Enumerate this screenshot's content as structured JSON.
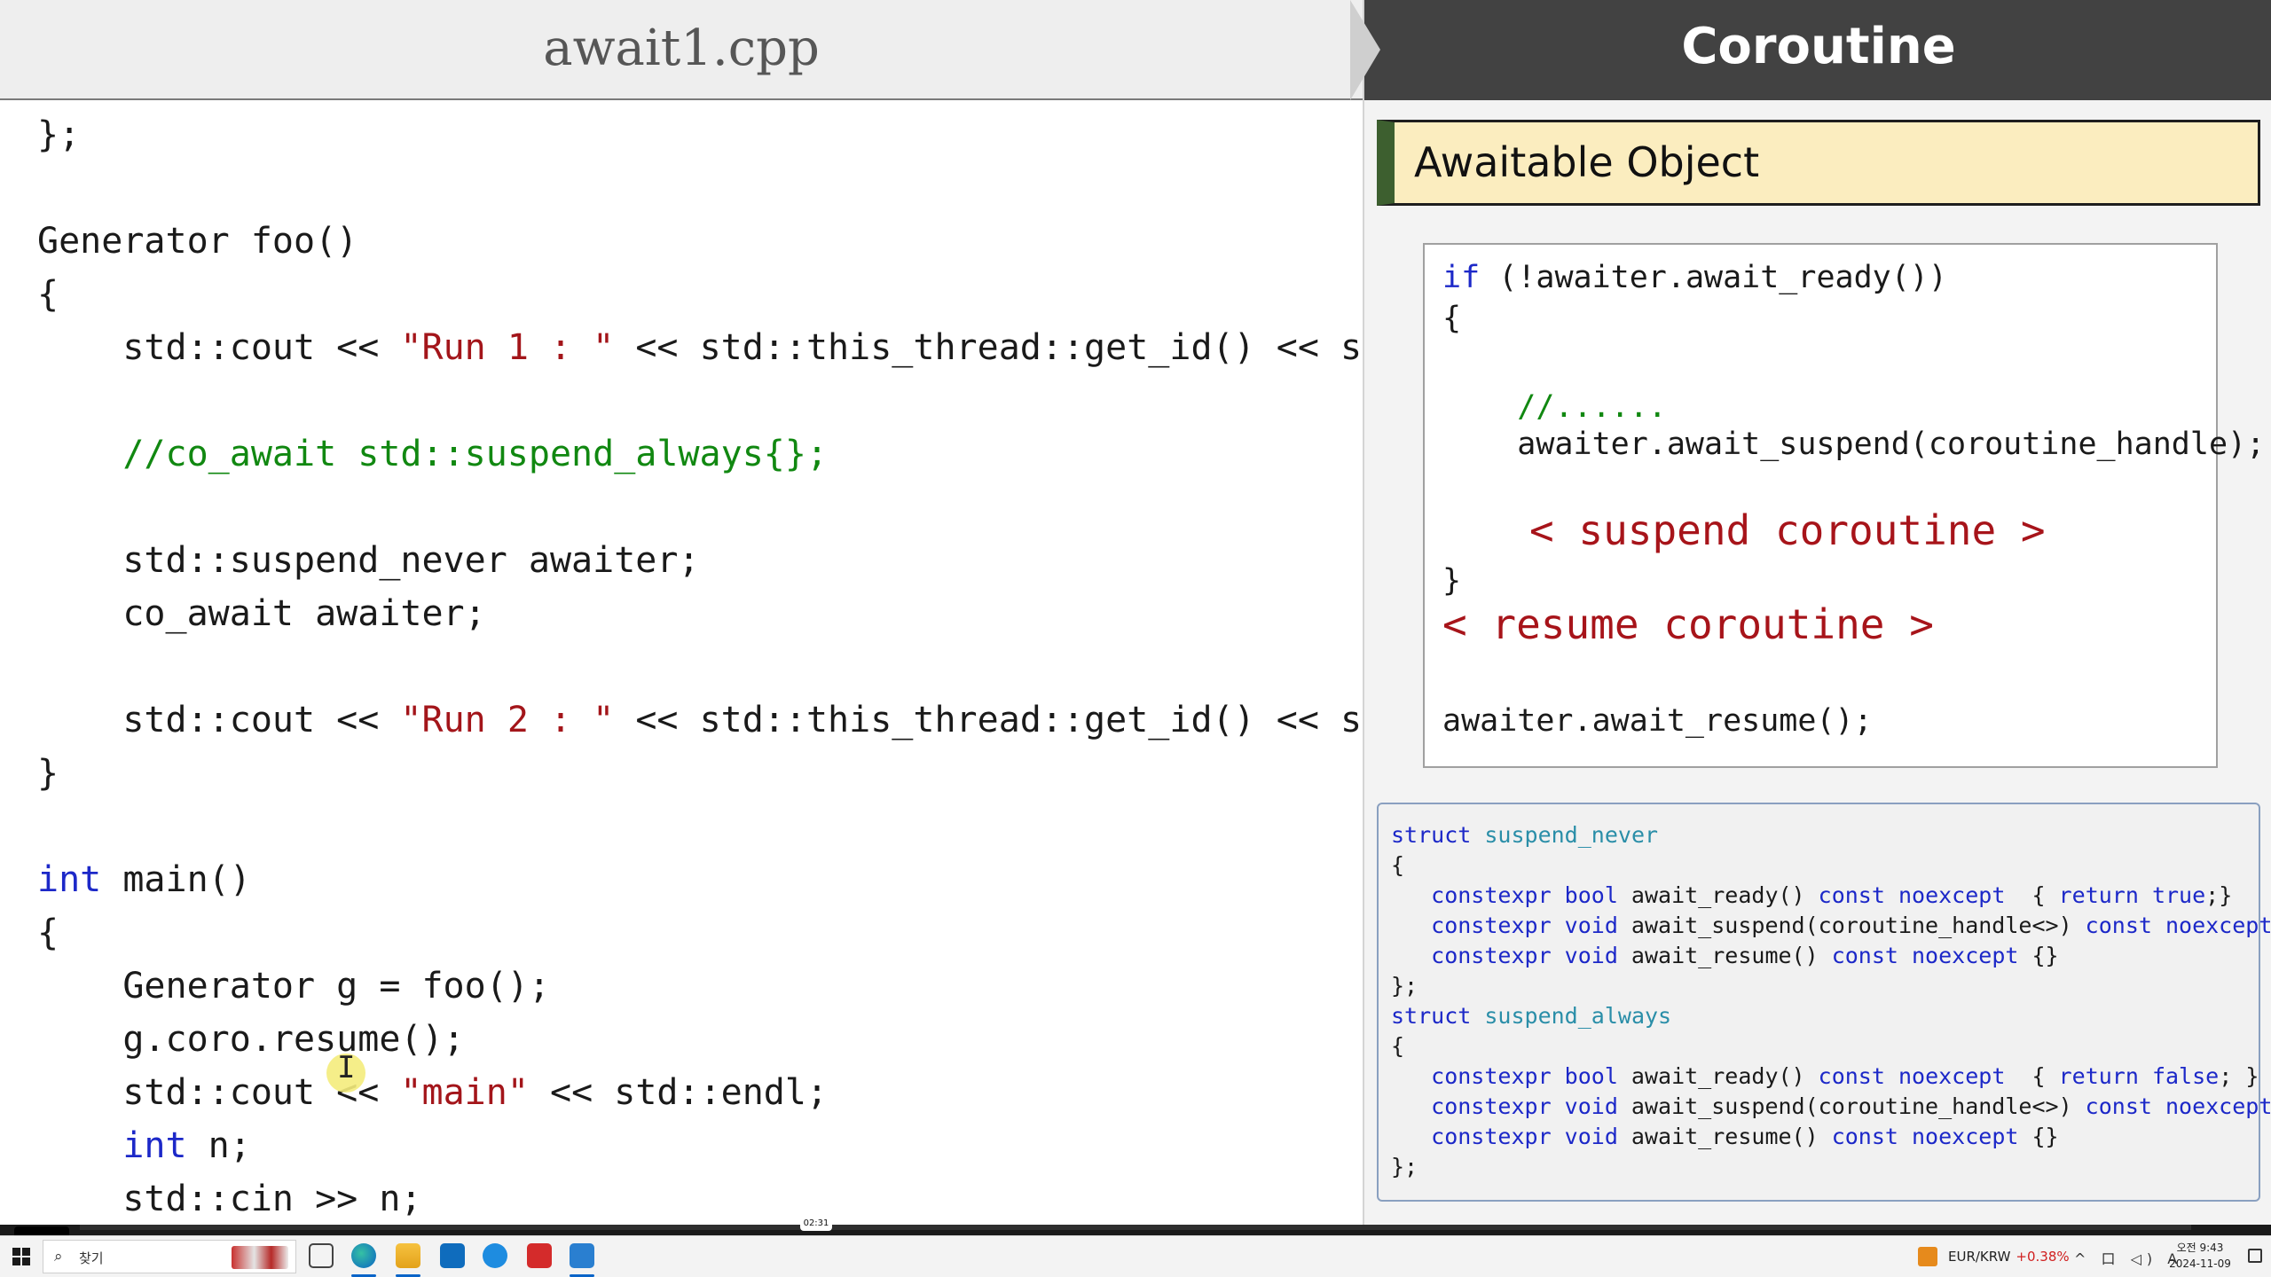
{
  "editor": {
    "filename": "await1.cpp",
    "lines": {
      "l1": "};",
      "l3a": "Generator foo()",
      "l4": "{",
      "l5a": "    std::cout << ",
      "l5b": "\"Run 1 : \"",
      "l5c": " << std::this_thread::get_id() << std::e",
      "l7": "    //co_await std::suspend_always{};",
      "l9": "    std::suspend_never awaiter;",
      "l10": "    co_await awaiter;",
      "l12a": "    std::cout << ",
      "l12b": "\"Run 2 : \"",
      "l12c": " << std::this_thread::get_id() << std::e",
      "l13": "}",
      "l15kw": "int",
      "l15": " main()",
      "l16": "{",
      "l17": "    Generator g = foo();",
      "l18": "    g.coro.resume();",
      "l19a": "    std::cout << ",
      "l19b": "\"main\"",
      "l19c": " << std::endl;",
      "l20ind": "    ",
      "l20kw": "int",
      "l20": " n;",
      "l21": "    std::cin >> n;"
    },
    "cursor_glyph": "I"
  },
  "slide": {
    "topic": "Coroutine",
    "section_title": "Awaitable Object",
    "pseudo": {
      "p1kw": "if",
      "p1": " (!awaiter.await_ready())",
      "p2": "{",
      "p3": "    //......",
      "p4": "    awaiter.await_suspend(coroutine_handle);",
      "p5": "< suspend coroutine >",
      "p6": "}",
      "p7": "< resume coroutine >",
      "p8": "awaiter.await_resume();"
    },
    "structs": {
      "s1kw": "struct",
      "s1name": "suspend_never",
      "s2": "{",
      "s3a": "   constexpr bool",
      "s3b": " await_ready() ",
      "s3c": "const noexcept",
      "s3d": "  { ",
      "s3e": "return true",
      "s3f": ";}",
      "s4a": "   constexpr void",
      "s4b": " await_suspend(coroutine_handle<>) ",
      "s4c": "const noexcept",
      "s4d": " {}",
      "s5a": "   constexpr void",
      "s5b": " await_resume() ",
      "s5c": "const noexcept",
      "s5d": " {}",
      "s6": "};",
      "s7kw": "struct",
      "s7name": "suspend_always",
      "s8": "{",
      "s9a": "   constexpr bool",
      "s9b": " await_ready() ",
      "s9c": "const noexcept",
      "s9d": "  { ",
      "s9e": "return false",
      "s9f": "; }",
      "s10a": "   constexpr void",
      "s10b": " await_suspend(coroutine_handle<>) ",
      "s10c": "const noexcept",
      "s10d": " {}",
      "s11a": "   constexpr void",
      "s11b": " await_resume() ",
      "s11c": "const noexcept",
      "s11d": " {}",
      "s12": "};"
    }
  },
  "player": {
    "time_label": "02:31"
  },
  "taskbar": {
    "search_icon": "search-icon",
    "search_placeholder": "찾기",
    "ticker": "EUR/KRW",
    "ticker_change": "+0.38%",
    "tray_icons": "^ 口 ◁) A",
    "time": "오전 9:43",
    "date": "2024-11-09"
  },
  "colors": {
    "keyword": "#1c28c8",
    "string": "#a3151a",
    "comment": "#118811",
    "type_name": "#2a8ea8",
    "banner_bg": "#fbedbf",
    "banner_accent": "#3d5f2f",
    "header_dark": "#424242"
  }
}
